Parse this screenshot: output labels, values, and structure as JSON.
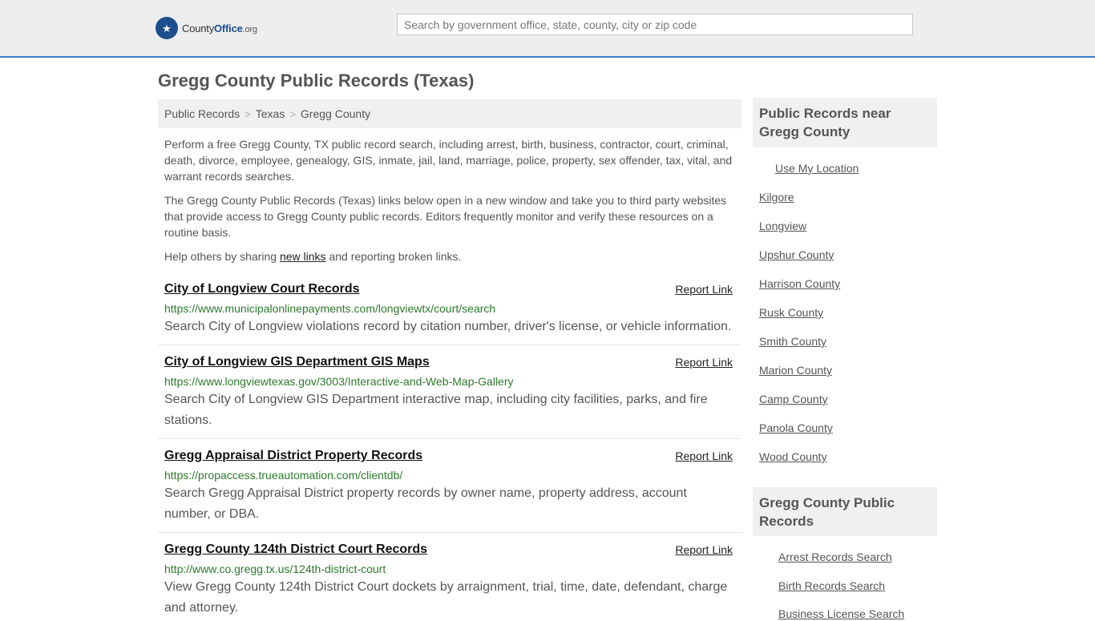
{
  "header": {
    "logo_county": "County",
    "logo_office": "Office",
    "logo_org": ".org",
    "search_placeholder": "Search by government office, state, county, city or zip code"
  },
  "page_title": "Gregg County Public Records (Texas)",
  "breadcrumb": [
    "Public Records",
    "Texas",
    "Gregg County"
  ],
  "intro": {
    "p1": "Perform a free Gregg County, TX public record search, including arrest, birth, business, contractor, court, criminal, death, divorce, employee, genealogy, GIS, inmate, jail, land, marriage, police, property, sex offender, tax, vital, and warrant records searches.",
    "p2": "The Gregg County Public Records (Texas) links below open in a new window and take you to third party websites that provide access to Gregg County public records. Editors frequently monitor and verify these resources on a routine basis.",
    "p3_before": "Help others by sharing ",
    "p3_link": "new links",
    "p3_after": " and reporting broken links."
  },
  "records": [
    {
      "title": "City of Longview Court Records",
      "report": "Report Link",
      "url": "https://www.municipalonlinepayments.com/longviewtx/court/search",
      "desc": "Search City of Longview violations record by citation number, driver's license, or vehicle information."
    },
    {
      "title": "City of Longview GIS Department GIS Maps",
      "report": "Report Link",
      "url": "https://www.longviewtexas.gov/3003/Interactive-and-Web-Map-Gallery",
      "desc": "Search City of Longview GIS Department interactive map, including city facilities, parks, and fire stations."
    },
    {
      "title": "Gregg Appraisal District Property Records",
      "report": "Report Link",
      "url": "https://propaccess.trueautomation.com/clientdb/",
      "desc": "Search Gregg Appraisal District property records by owner name, property address, account number, or DBA."
    },
    {
      "title": "Gregg County 124th District Court Records",
      "report": "Report Link",
      "url": "http://www.co.gregg.tx.us/124th-district-court",
      "desc": "View Gregg County 124th District Court dockets by arraignment, trial, time, date, defendant, charge and attorney."
    }
  ],
  "sidebar": {
    "nearby_heading": "Public Records near Gregg County",
    "use_location": "Use My Location",
    "nearby": [
      "Kilgore",
      "Longview",
      "Upshur County",
      "Harrison County",
      "Rusk County",
      "Smith County",
      "Marion County",
      "Camp County",
      "Panola County",
      "Wood County"
    ],
    "county_heading": "Gregg County Public Records",
    "county_links": [
      "Arrest Records Search",
      "Birth Records Search",
      "Business License Search"
    ]
  }
}
